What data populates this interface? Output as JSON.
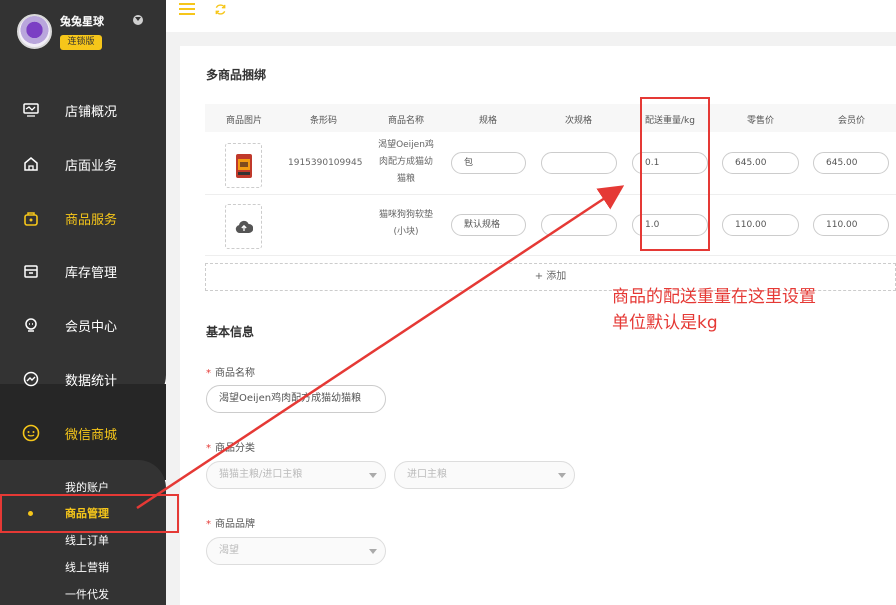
{
  "sidebar": {
    "store_name": "兔兔星球",
    "badge": "连锁版",
    "items": [
      {
        "label": "店铺概况",
        "icon": "monitor-icon"
      },
      {
        "label": "店面业务",
        "icon": "home-icon"
      },
      {
        "label": "商品服务",
        "icon": "bag-icon"
      },
      {
        "label": "库存管理",
        "icon": "box-icon"
      },
      {
        "label": "会员中心",
        "icon": "member-icon"
      },
      {
        "label": "数据统计",
        "icon": "chart-icon"
      },
      {
        "label": "微信商城",
        "icon": "wechat-icon"
      }
    ],
    "sub_items": [
      "我的账户",
      "商品管理",
      "线上订单",
      "线上营销",
      "一件代发"
    ]
  },
  "section1": {
    "title": "多商品捆绑",
    "columns": [
      "商品图片",
      "条形码",
      "商品名称",
      "规格",
      "次规格",
      "配送重量/kg",
      "零售价",
      "会员价"
    ],
    "rows": [
      {
        "barcode": "1915390109945",
        "name": [
          "渴望Oeijen鸡",
          "肉配方成猫幼",
          "猫粮"
        ],
        "spec": "包",
        "subspec": "",
        "weight": "0.1",
        "retail": "645.00",
        "member": "645.00"
      },
      {
        "barcode": "",
        "name": [
          "猫咪狗狗软垫",
          "(小块)"
        ],
        "spec": "默认规格",
        "subspec": "",
        "weight": "1.0",
        "retail": "110.00",
        "member": "110.00"
      }
    ],
    "add_label": "+ 添加"
  },
  "section2": {
    "title": "基本信息",
    "name_label": "商品名称",
    "name_value": "渴望Oeijen鸡肉配方成猫幼猫粮",
    "category_label": "商品分类",
    "category_1": "猫猫主粮/进口主粮",
    "category_2": "进口主粮",
    "brand_label": "商品品牌",
    "brand_value": "渴望"
  },
  "annotation": {
    "line1": "商品的配送重量在这里设置",
    "line2": "单位默认是kg",
    "color": "#e53935"
  },
  "colors": {
    "accent": "#f6c61a",
    "sidebar": "#333333"
  }
}
